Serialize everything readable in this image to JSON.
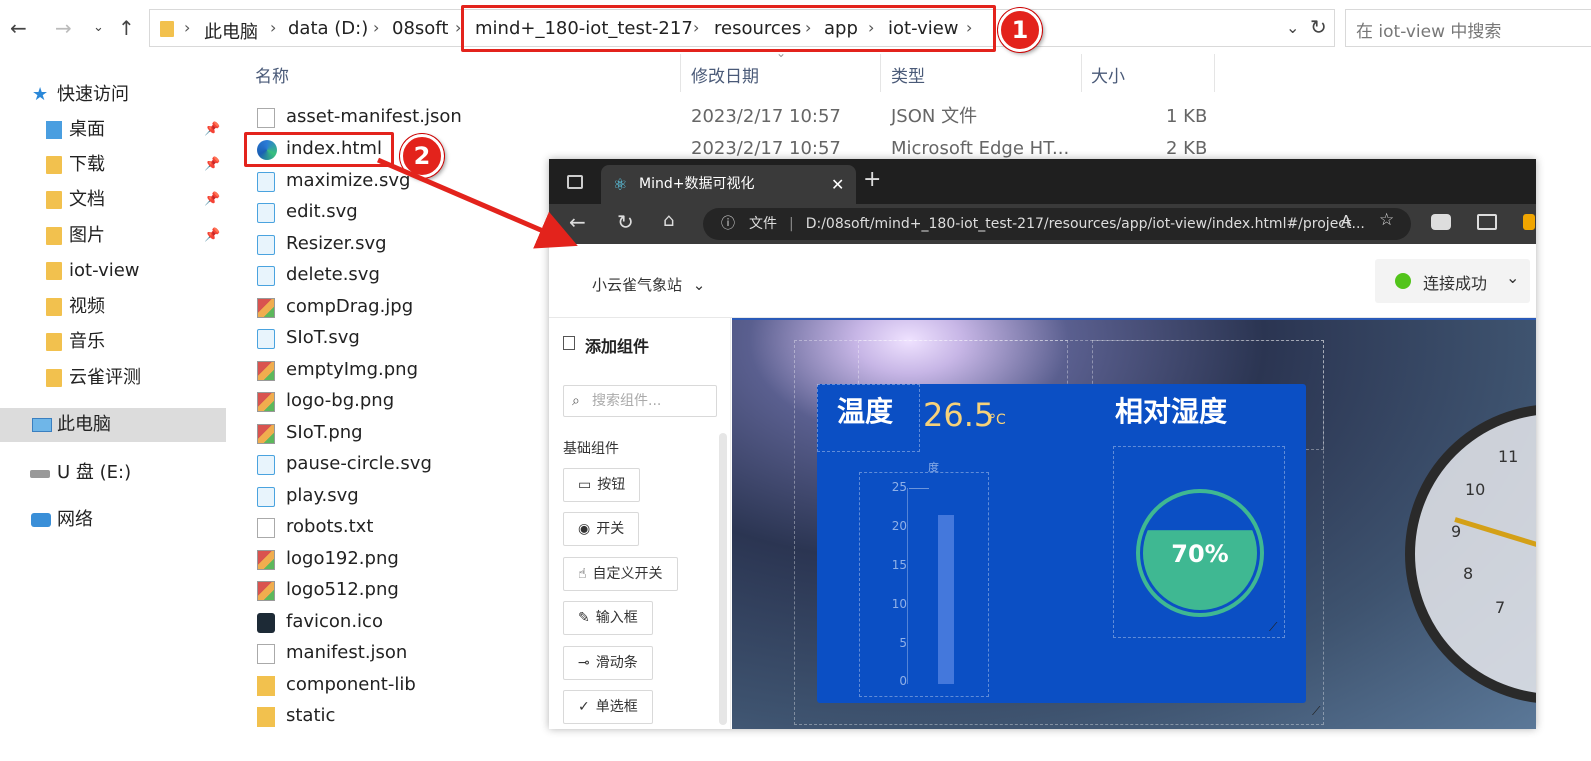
{
  "explorer": {
    "breadcrumb": [
      "此电脑",
      "data (D:)",
      "08soft",
      "mind+_180-iot_test-217",
      "resources",
      "app",
      "iot-view"
    ],
    "search_placeholder": "在 iot-view 中搜索",
    "annotations": [
      "1",
      "2"
    ],
    "sidebar": {
      "quick_access": "快速访问",
      "items": [
        {
          "label": "桌面",
          "pinned": true
        },
        {
          "label": "下载",
          "pinned": true
        },
        {
          "label": "文档",
          "pinned": true
        },
        {
          "label": "图片",
          "pinned": true
        },
        {
          "label": "iot-view",
          "pinned": false
        },
        {
          "label": "视频",
          "pinned": false
        },
        {
          "label": "音乐",
          "pinned": false
        },
        {
          "label": "云雀评测",
          "pinned": false
        }
      ],
      "this_pc": "此电脑",
      "usb": "U 盘 (E:)",
      "network": "网络"
    },
    "columns": {
      "name": "名称",
      "date": "修改日期",
      "type": "类型",
      "size": "大小"
    },
    "files": [
      {
        "name": "asset-manifest.json",
        "icon": "doc",
        "date": "2023/2/17 10:57",
        "type": "JSON 文件",
        "size": "1 KB"
      },
      {
        "name": "index.html",
        "icon": "edge",
        "date": "2023/2/17 10:57",
        "type": "Microsoft Edge HT...",
        "size": "2 KB"
      },
      {
        "name": "maximize.svg",
        "icon": "svg"
      },
      {
        "name": "edit.svg",
        "icon": "svg"
      },
      {
        "name": "Resizer.svg",
        "icon": "svg"
      },
      {
        "name": "delete.svg",
        "icon": "svg"
      },
      {
        "name": "compDrag.jpg",
        "icon": "img"
      },
      {
        "name": "SIoT.svg",
        "icon": "svg"
      },
      {
        "name": "emptyImg.png",
        "icon": "img"
      },
      {
        "name": "logo-bg.png",
        "icon": "img"
      },
      {
        "name": "SIoT.png",
        "icon": "img"
      },
      {
        "name": "pause-circle.svg",
        "icon": "svg"
      },
      {
        "name": "play.svg",
        "icon": "svg"
      },
      {
        "name": "robots.txt",
        "icon": "doc"
      },
      {
        "name": "logo192.png",
        "icon": "img"
      },
      {
        "name": "logo512.png",
        "icon": "img"
      },
      {
        "name": "favicon.ico",
        "icon": "ico"
      },
      {
        "name": "manifest.json",
        "icon": "doc"
      },
      {
        "name": "component-lib",
        "icon": "fold"
      },
      {
        "name": "static",
        "icon": "fold"
      }
    ]
  },
  "browser": {
    "tab_title": "Mind+数据可视化",
    "file_label": "文件",
    "url": "D:/08soft/mind+_180-iot_test-217/resources/app/iot-view/index.html#/project...",
    "app": {
      "project": "小云雀气象站",
      "status": "连接成功",
      "status_color": "#52c41a",
      "panel_title": "添加组件",
      "search_placeholder": "搜索组件...",
      "section": "基础组件",
      "components": [
        "按钮",
        "开关",
        "自定义开关",
        "输入框",
        "滑动条",
        "单选框"
      ],
      "temp_title": "温度",
      "temp_value": "26.5",
      "temp_unit": "°C",
      "temp_axis_label": "度",
      "temp_ticks": [
        "25",
        "20",
        "15",
        "10",
        "5",
        "0"
      ],
      "temp_reading": 21.5,
      "humidity_title": "相对湿度",
      "humidity_value": "70%",
      "humidity_fraction": 0.7,
      "clock_numbers": [
        "11",
        "10",
        "9",
        "8",
        "7"
      ]
    }
  }
}
